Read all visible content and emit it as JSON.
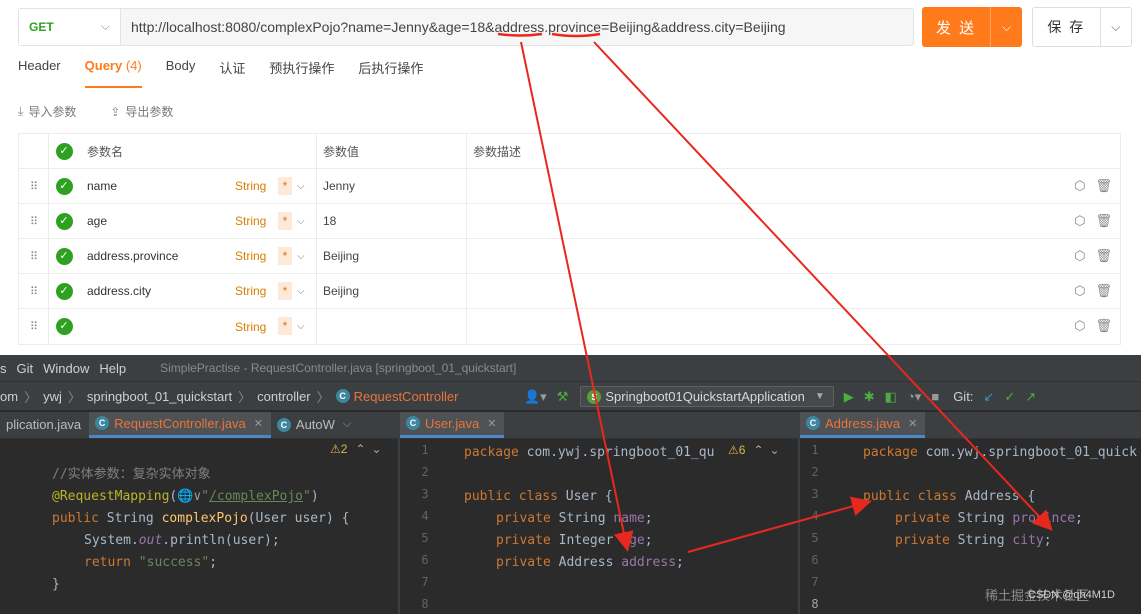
{
  "request": {
    "method": "GET",
    "url": "http://localhost:8080/complexPojo?name=Jenny&age=18&address.province=Beijing&address.city=Beijing",
    "send_label": "发 送",
    "save_label": "保 存"
  },
  "tabs": [
    {
      "label": "Header"
    },
    {
      "label": "Query",
      "badge": "(4)"
    },
    {
      "label": "Body"
    },
    {
      "label": "认证"
    },
    {
      "label": "预执行操作"
    },
    {
      "label": "后执行操作"
    }
  ],
  "tools": {
    "import_label": "导入参数",
    "export_label": "导出参数"
  },
  "params": {
    "headers": {
      "name": "参数名",
      "value": "参数值",
      "desc": "参数描述"
    },
    "rows": [
      {
        "name": "name",
        "type": "String",
        "required": "*",
        "value": "Jenny",
        "desc": ""
      },
      {
        "name": "age",
        "type": "String",
        "required": "*",
        "value": "18",
        "desc": ""
      },
      {
        "name": "address.province",
        "type": "String",
        "required": "*",
        "value": "Beijing",
        "desc": ""
      },
      {
        "name": "address.city",
        "type": "String",
        "required": "*",
        "value": "Beijing",
        "desc": ""
      },
      {
        "name": "",
        "type": "String",
        "required": "*",
        "value": "",
        "desc": ""
      }
    ]
  },
  "ide": {
    "menu": [
      "s",
      "Git",
      "Window",
      "Help"
    ],
    "title": "SimplePractise - RequestController.java [springboot_01_quickstart]",
    "breadcrumb": [
      "om",
      "ywj",
      "springboot_01_quickstart",
      "controller",
      "RequestController"
    ],
    "run_config": "Springboot01QuickstartApplication",
    "git_label": "Git:",
    "tabs": {
      "left": [
        "plication.java",
        "RequestController.java",
        "AutoW"
      ],
      "middle": "User.java",
      "right": "Address.java"
    },
    "left_code": {
      "warning_count": "2",
      "comment": "//实体参数：复杂实体对象",
      "mapping_annotation": "@RequestMapping",
      "mapping_path": "/complexPojo",
      "signature_kw": "public ",
      "signature_type": "String ",
      "signature_fn": "complexPojo",
      "signature_params": "(User user) {",
      "print_stmt": "System.",
      "print_out": "out",
      "print_rest": ".println(user);",
      "return_kw": "return ",
      "return_val": "\"success\"",
      "close": "}"
    },
    "middle_code": {
      "lines": [
        "1",
        "2",
        "3",
        "4",
        "5",
        "6",
        "7",
        "8"
      ],
      "warning_count": "6",
      "package_line": "com.ywj.springboot_01_qu",
      "class_name": "User",
      "fields": [
        {
          "type": "String",
          "name": "name"
        },
        {
          "type": "Integer",
          "name": "age"
        },
        {
          "type": "Address",
          "name": "address"
        }
      ]
    },
    "right_code": {
      "lines": [
        "1",
        "2",
        "3",
        "4",
        "5",
        "6",
        "7",
        "8"
      ],
      "package_line": "com.ywj.springboot_01_quick",
      "class_name": "Address",
      "fields": [
        {
          "type": "String",
          "name": "province"
        },
        {
          "type": "String",
          "name": "city"
        }
      ]
    },
    "watermark": "稀土掘金技术社区",
    "watermark2": "CSDN @qh4M1D"
  },
  "colors": {
    "accent": "#ff7a1a",
    "annotation_red": "#e8281f",
    "get_green": "#2ea121"
  }
}
